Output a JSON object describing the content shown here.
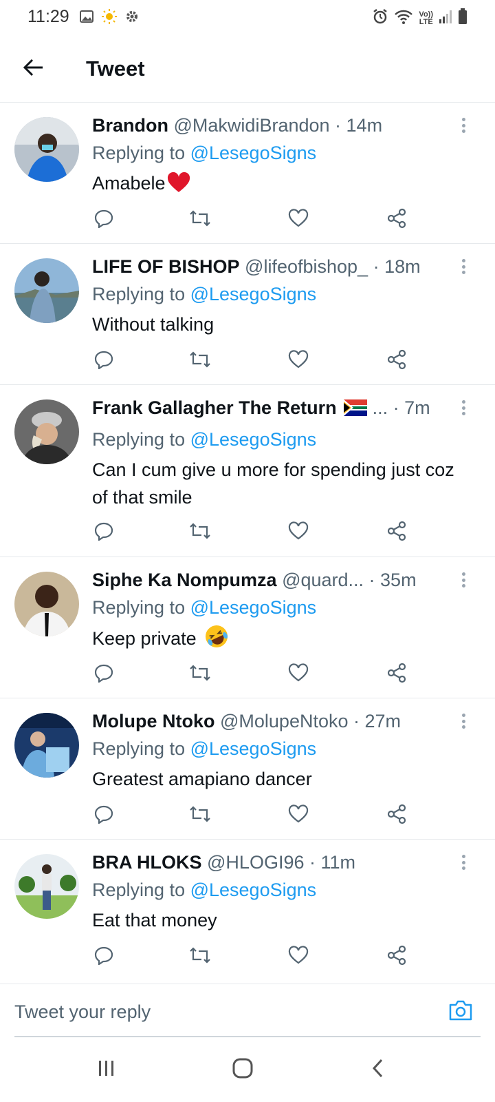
{
  "status_bar": {
    "time": "11:29",
    "left_icons": [
      "image-icon",
      "sun-icon",
      "gear-icon"
    ],
    "right_icons": [
      "alarm-icon",
      "wifi-icon",
      "volte-icon",
      "signal-icon",
      "battery-icon"
    ],
    "volte_top": "Vo))",
    "volte_bottom": "LTE"
  },
  "header": {
    "title": "Tweet",
    "back_icon": "arrow-left-icon"
  },
  "colors": {
    "accent": "#1d9bf0",
    "text_primary": "#0f1419",
    "text_secondary": "#536471",
    "divider": "#e6e9ec"
  },
  "replies": [
    {
      "display_name": "Brandon",
      "handle": "@MakwidiBrandon",
      "time": "· 14m",
      "replying_prefix": "Replying to ",
      "replying_to": "@LesegoSigns",
      "text": "Amabele",
      "emoji": "red-heart-icon"
    },
    {
      "display_name": "LIFE OF BISHOP",
      "handle": "@lifeofbishop_",
      "time": "· 18m",
      "replying_prefix": "Replying to ",
      "replying_to": "@LesegoSigns",
      "text": "Without talking"
    },
    {
      "display_name": "Frank Gallagher The Return",
      "handle": "...",
      "time": "· 7m",
      "flag": "south-africa-flag-icon",
      "replying_prefix": "Replying to ",
      "replying_to": "@LesegoSigns",
      "text": "Can I cum give u more for spending just coz of that smile"
    },
    {
      "display_name": "Siphe Ka Nompumza",
      "handle": "@quard...",
      "time": "· 35m",
      "replying_prefix": "Replying to ",
      "replying_to": "@LesegoSigns",
      "text": "Keep private",
      "emoji": "rolling-laughing-icon"
    },
    {
      "display_name": "Molupe Ntoko",
      "handle": "@MolupeNtoko",
      "time": "· 27m",
      "replying_prefix": "Replying to ",
      "replying_to": "@LesegoSigns",
      "text": "Greatest amapiano dancer"
    },
    {
      "display_name": "BRA HLOKS",
      "handle": "@HLOGI96",
      "time": "· 11m",
      "replying_prefix": "Replying to ",
      "replying_to": "@LesegoSigns",
      "text": "Eat that money"
    }
  ],
  "actions": [
    "reply-icon",
    "retweet-icon",
    "like-icon",
    "share-icon"
  ],
  "reply_bar": {
    "placeholder": "Tweet your reply",
    "camera_icon": "camera-icon"
  },
  "nav_bar": {
    "items": [
      "recent-apps-icon",
      "home-icon",
      "back-icon"
    ]
  }
}
